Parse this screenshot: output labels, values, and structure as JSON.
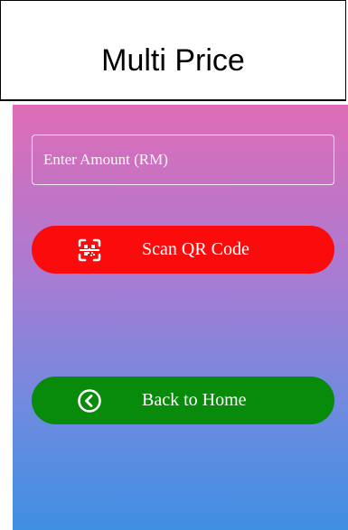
{
  "header": {
    "title": "Multi Price"
  },
  "amount_input": {
    "placeholder": "Enter Amount (RM)",
    "value": ""
  },
  "scan_button": {
    "label": "Scan QR Code",
    "icon": "qr-scan-icon",
    "color": "#fb0b0b"
  },
  "home_button": {
    "label": "Back to Home",
    "icon": "back-circle-icon",
    "color": "#088a0b"
  },
  "colors": {
    "gradient_top": "#df6cb6",
    "gradient_bottom": "#3f8fe2",
    "text": "#ffffff"
  }
}
